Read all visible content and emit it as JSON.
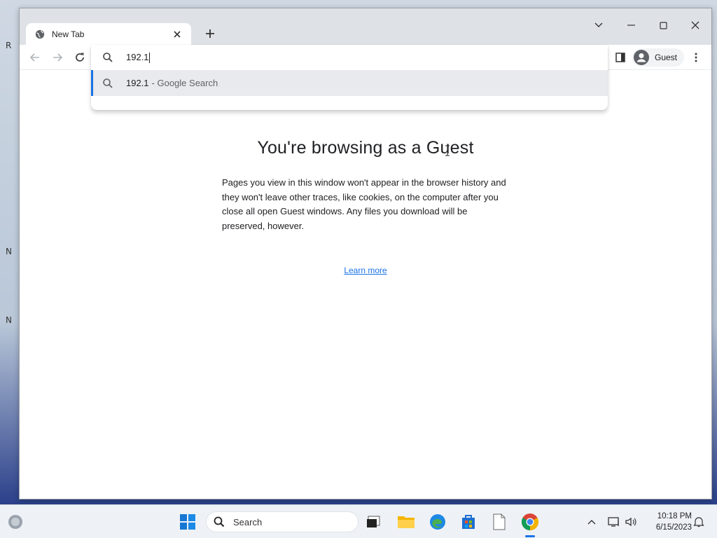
{
  "browser": {
    "tab": {
      "title": "New Tab"
    },
    "omnibox": {
      "input_value": "192.1",
      "suggestion": {
        "text": "192.1",
        "description": "- Google Search"
      }
    },
    "profile": {
      "label": "Guest"
    }
  },
  "page": {
    "title": "You're browsing as a Guest",
    "description": "Pages you view in this window won't appear in the browser history and they won't leave other traces, like cookies, on the computer after you close all open Guest windows. Any files you download will be preserved, however.",
    "learn_more": "Learn more"
  },
  "taskbar": {
    "search_label": "Search",
    "clock": {
      "time": "10:18 PM",
      "date": "6/15/2023"
    }
  },
  "colors": {
    "accent": "#1a73e8",
    "tabstrip": "#dee1e6",
    "suggestion_bg": "#e8eaed"
  }
}
